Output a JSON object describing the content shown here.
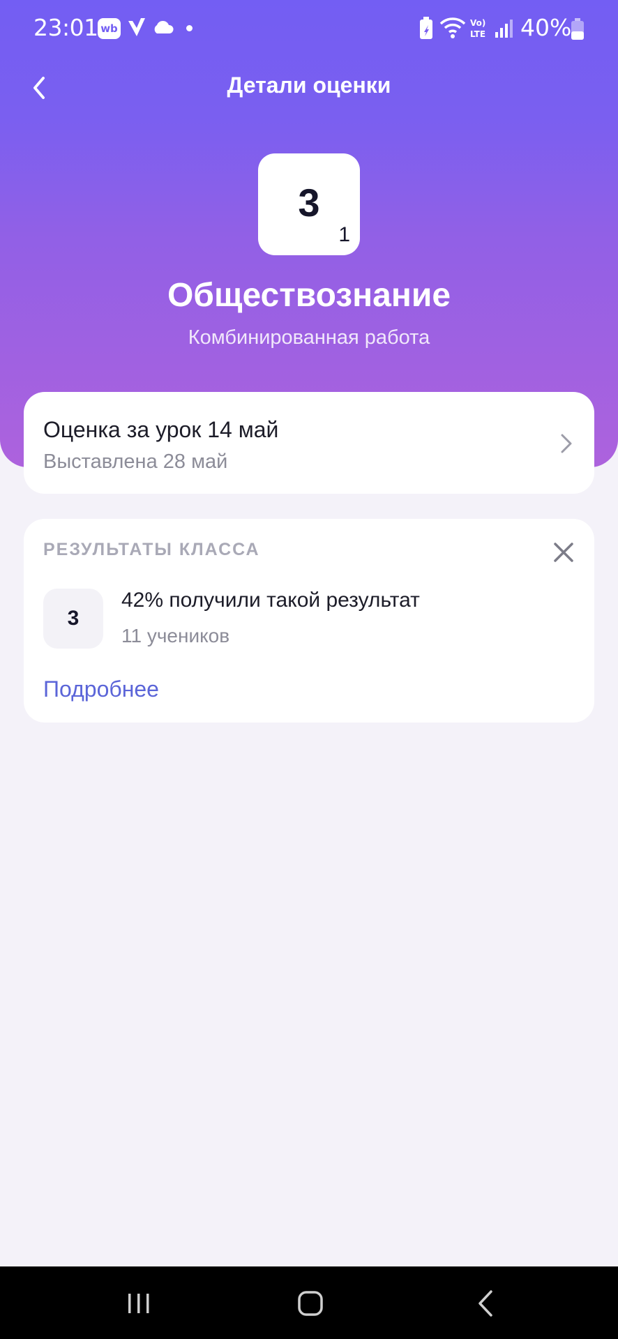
{
  "status_bar": {
    "time": "23:01",
    "wb_badge": "wb",
    "battery_percent": "40%",
    "icons": [
      "wb-app-icon",
      "vk-icon",
      "cloud-icon",
      "notification-dot",
      "battery-saver-icon",
      "wifi-icon",
      "volte-lte-icon",
      "signal-icon",
      "battery-icon"
    ]
  },
  "header": {
    "title": "Детали оценки",
    "back_icon": "chevron-left-icon"
  },
  "grade": {
    "value": "3",
    "weight": "1",
    "subject": "Обществознание",
    "work_type": "Комбинированная работа"
  },
  "lesson_card": {
    "title": "Оценка за урок 14 май",
    "subtitle": "Выставлена 28 май",
    "chevron_icon": "chevron-right-icon"
  },
  "results_card": {
    "header": "РЕЗУЛЬТАТЫ КЛАССА",
    "close_icon": "close-icon",
    "grade": "3",
    "percent_text": "42% получили такой результат",
    "students_text": "11 учеников",
    "more_link": "Подробнее"
  },
  "nav_bar": {
    "buttons": [
      "recents-icon",
      "home-icon",
      "back-icon"
    ]
  },
  "colors": {
    "gradient_top": "#735ef3",
    "gradient_bottom": "#ad62dd",
    "background": "#f4f2f9",
    "link": "#5b65d8",
    "muted_text": "#8c8c98"
  }
}
